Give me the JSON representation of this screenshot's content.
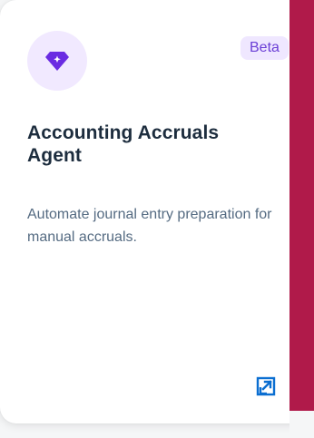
{
  "card": {
    "title": "Accounting Accruals Agent",
    "badge": "Beta",
    "description": "Automate journal entry preparation for manual accruals.",
    "icon": "diamond-sparkle-icon",
    "action_icon": "open-external-icon"
  },
  "colors": {
    "background": "#f5f6f7",
    "card": "#ffffff",
    "accent_purple": "#6b3fd6",
    "icon_bg": "#f1e9ff",
    "title": "#1d2d3e",
    "description": "#556b82",
    "action_blue": "#0a6ed1",
    "side_band": "#b01a4a"
  }
}
